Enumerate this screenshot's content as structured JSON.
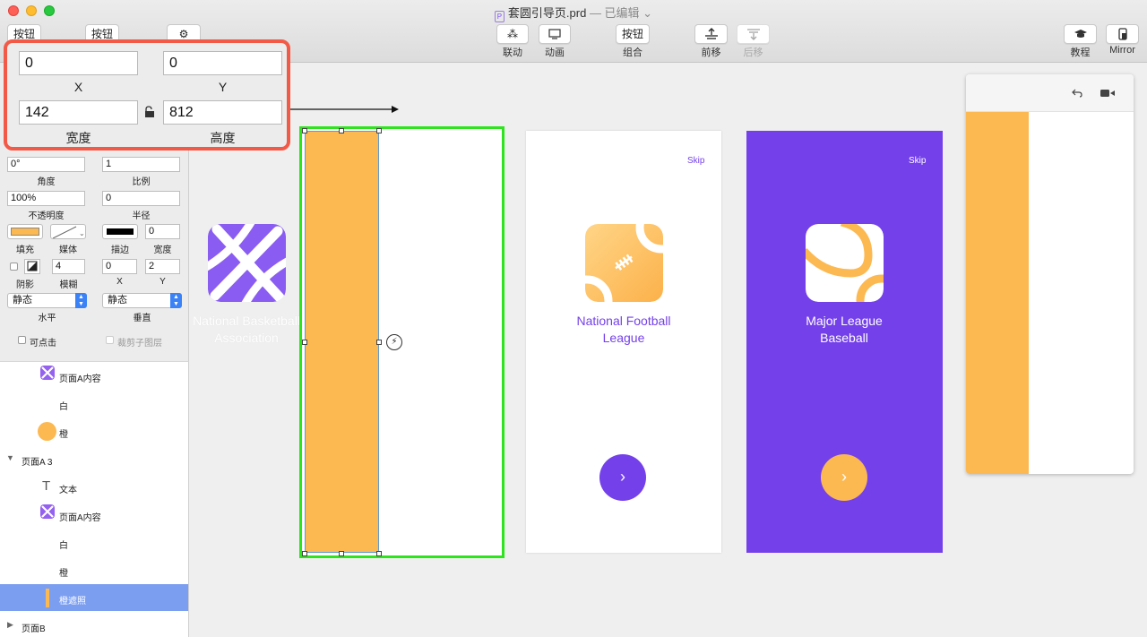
{
  "window": {
    "title": "套圆引导页.prd",
    "status": "— 已编辑",
    "doc_icon": "P"
  },
  "toolbar": {
    "left_btn1": "按钮",
    "left_btn2": "按钮",
    "gear_icon": "gear-icon",
    "link_label": "联动",
    "link_icon": "grid-link-icon",
    "anim_label": "动画",
    "anim_icon": "monitor-icon",
    "group_btn": "按钮",
    "group_label": "组合",
    "forward_label": "前移",
    "backward_label": "后移",
    "tutorial_label": "教程",
    "mirror_label": "Mirror"
  },
  "inspector": {
    "x_value": "0",
    "x_label": "X",
    "y_value": "0",
    "y_label": "Y",
    "width_value": "142",
    "width_label": "宽度",
    "height_value": "812",
    "height_label": "高度",
    "angle_value": "0°",
    "angle_label": "角度",
    "scale_value": "1",
    "scale_label": "比例",
    "opacity_value": "100%",
    "opacity_label": "不透明度",
    "radius_value": "0",
    "radius_label": "半径",
    "fill_label": "填充",
    "fill_color": "#fcb952",
    "media_label": "媒体",
    "stroke_label": "描边",
    "stroke_width_value": "0",
    "stroke_width_label": "宽度",
    "shadow_label": "阴影",
    "blur_value": "4",
    "blur_label": "模糊",
    "shadow_x_value": "0",
    "shadow_x_label": "X",
    "shadow_y_value": "2",
    "shadow_y_label": "Y",
    "horizontal_value": "静态",
    "horizontal_label": "水平",
    "vertical_value": "静态",
    "vertical_label": "垂直",
    "clickable_label": "可点击",
    "clip_label": "裁剪子图层"
  },
  "layers": [
    {
      "name": "页面A内容",
      "icon": "app-icon"
    },
    {
      "name": "白",
      "icon": ""
    },
    {
      "name": "橙",
      "icon": "orange-circle-icon"
    },
    {
      "name": "页面A 3",
      "icon": "disclosure-open-icon"
    },
    {
      "name": "文本",
      "icon": "text-icon"
    },
    {
      "name": "页面A内容",
      "icon": "app-icon"
    },
    {
      "name": "白",
      "icon": ""
    },
    {
      "name": "橙",
      "icon": ""
    },
    {
      "name": "橙遮照",
      "icon": "orange-bar-icon",
      "selected": true
    },
    {
      "name": "页面B",
      "icon": "disclosure-closed-icon"
    }
  ],
  "canvas": {
    "card1_title_line1": "National Basketball",
    "card1_title_line2": "Association",
    "card2_skip": "Skip",
    "card2_title_line1": "National Football",
    "card2_title_line2": "League",
    "card3_skip": "Skip",
    "card3_title_line1": "Major League",
    "card3_title_line2": "Baseball",
    "next_icon": "chevron-right-icon",
    "colors": {
      "orange": "#fcb952",
      "purple": "#7440ea",
      "selection_green": "#2ee51d",
      "highlight_red": "#f25a47"
    }
  },
  "preview": {
    "undo_icon": "undo-icon",
    "camera_icon": "camera-icon"
  }
}
